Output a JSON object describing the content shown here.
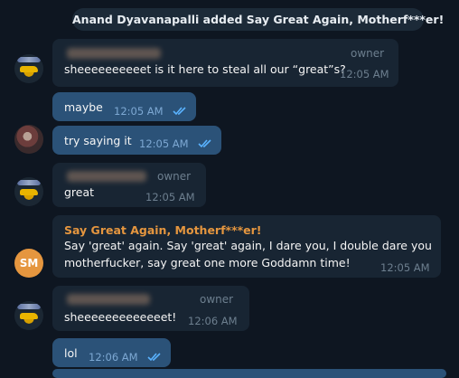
{
  "service_message": "Anand Dyavanapalli added Say Great Again, Motherf***er!",
  "messages": [
    {
      "role": "owner",
      "text": "sheeeeeeeeeet is it here to steal all our “great”s?",
      "time": "12:05 AM",
      "avatar": "car-avatar"
    },
    {
      "text": "maybe",
      "time": "12:05 AM",
      "outgoing": true
    },
    {
      "text": "try saying it",
      "time": "12:05 AM",
      "outgoing": true,
      "avatar": "photo-avatar"
    },
    {
      "role": "owner",
      "text": "great",
      "time": "12:05 AM",
      "avatar": "car-avatar"
    },
    {
      "sender": "Say Great Again, Motherf***er!",
      "line1": "Say 'great' again. Say 'great' again, I dare you, I double dare you",
      "line2": "motherfucker, say great one more Goddamn time!",
      "time": "12:05 AM",
      "avatar": "SM"
    },
    {
      "role": "owner",
      "text": "sheeeeeeeeeeeeet!",
      "time": "12:06 AM",
      "avatar": "car-avatar"
    },
    {
      "text": "lol",
      "time": "12:06 AM",
      "outgoing": true
    }
  ],
  "colors": {
    "background": "#0e1621",
    "incoming_bubble": "#182533",
    "outgoing_bubble": "#2b5278",
    "bot_name": "#e5963f",
    "read_tick": "#5ab3ff"
  }
}
